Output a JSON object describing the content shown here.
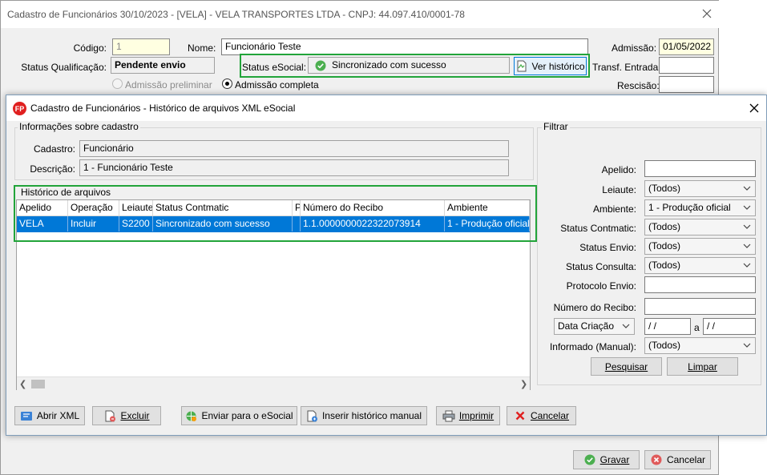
{
  "back_window": {
    "title": "Cadastro de Funcionários  30/10/2023 - [VELA] - VELA TRANSPORTES LTDA - CNPJ: 44.097.410/0001-78",
    "codigo_label": "Código:",
    "codigo_value": "1",
    "nome_label": "Nome:",
    "nome_value": "Funcionário Teste",
    "admissao_label": "Admissão:",
    "admissao_value": "01/05/2022",
    "status_qualificacao_label": "Status Qualificação:",
    "status_qualificacao_value": "Pendente envio",
    "status_esocial_label": "Status eSocial:",
    "status_esocial_value": "Sincronizado com sucesso",
    "ver_historico_button": "Ver histórico",
    "transf_entrada_label": "Transf. Entrada:",
    "rescisao_label": "Rescisão:",
    "admissao_preliminar": "Admissão preliminar",
    "admissao_completa": "Admissão completa",
    "gravar_button": "Gravar",
    "cancelar_button": "Cancelar"
  },
  "dialog": {
    "title": "Cadastro de Funcionários - Histórico de arquivos XML eSocial",
    "info_group_title": "Informações sobre cadastro",
    "cadastro_label": "Cadastro:",
    "cadastro_value": "Funcionário",
    "descricao_label": "Descrição:",
    "descricao_value": "1 - Funcionário Teste",
    "historico_group_title": "Histórico de arquivos",
    "table": {
      "columns": [
        "Apelido",
        "Operação",
        "Leiaute",
        "Status Contmatic",
        "P",
        "Número do Recibo",
        "Ambiente"
      ],
      "rows": [
        [
          "VELA",
          "Incluir",
          "S2200",
          "Sincronizado com sucesso",
          "",
          "1.1.0000000022322073914",
          "1 - Produção oficial"
        ]
      ]
    },
    "filter": {
      "title": "Filtrar",
      "apelido_label": "Apelido:",
      "leiaute_label": "Leiaute:",
      "leiaute_value": "(Todos)",
      "ambiente_label": "Ambiente:",
      "ambiente_value": "1 - Produção oficial",
      "status_contmatic_label": "Status Contmatic:",
      "status_contmatic_value": "(Todos)",
      "status_envio_label": "Status Envio:",
      "status_envio_value": "(Todos)",
      "status_consulta_label": "Status Consulta:",
      "status_consulta_value": "(Todos)",
      "protocolo_envio_label": "Protocolo Envio:",
      "numero_recibo_label": "Número do Recibo:",
      "data_criacao_value": "Data Criação",
      "date_from": " /  /",
      "a_label": "a",
      "date_to": " /  /",
      "informado_label": "Informado (Manual):",
      "informado_value": "(Todos)",
      "pesquisar_button": "Pesquisar",
      "limpar_button": "Limpar"
    },
    "buttons": {
      "abrir_xml": "Abrir XML",
      "excluir": "Excluir",
      "enviar_esocial": "Enviar para o eSocial",
      "inserir_historico": "Inserir histórico manual",
      "imprimir": "Imprimir",
      "cancelar": "Cancelar"
    }
  },
  "colors": {
    "highlight_green": "#22a43a",
    "selection_blue": "#0078d7",
    "app_icon_red": "#e02020"
  }
}
